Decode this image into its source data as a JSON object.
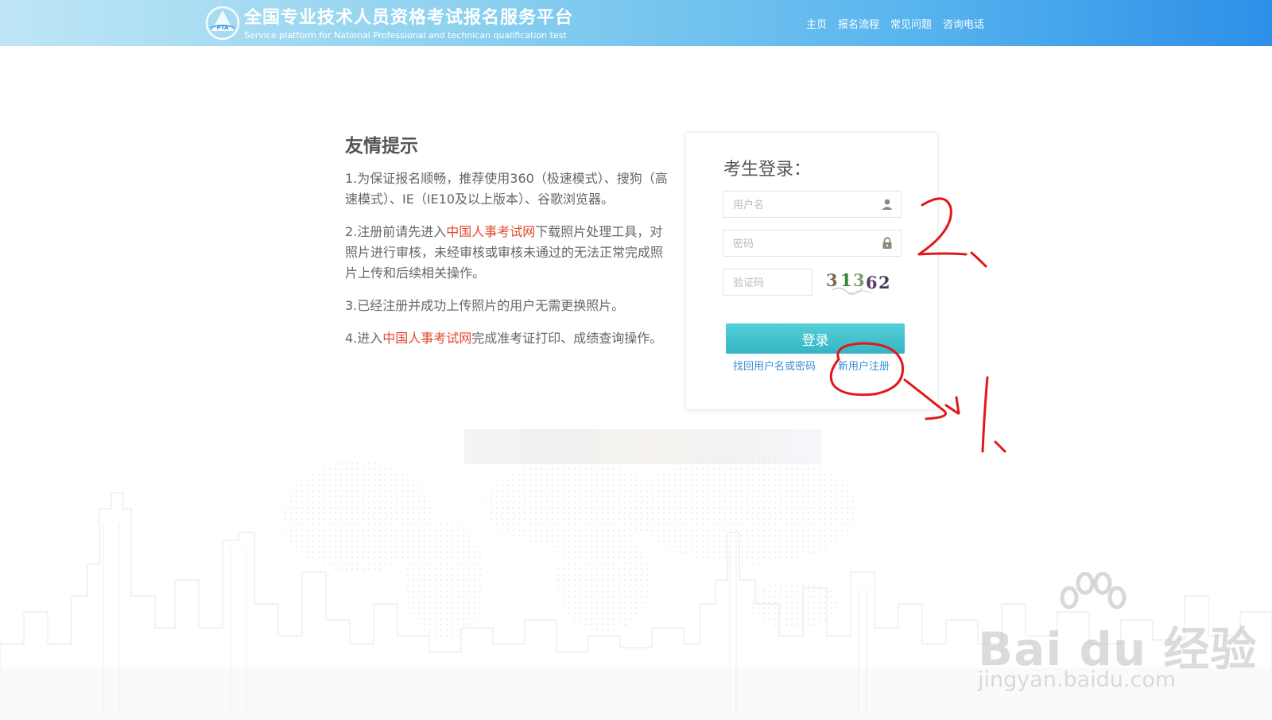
{
  "header": {
    "title": "全国专业技术人员资格考试报名服务平台",
    "subtitle": "Service platform for National Professional and technican qualification test",
    "logo_text": "PTA",
    "nav": [
      "主页",
      "报名流程",
      "常见问题",
      "咨询电话"
    ]
  },
  "tips": {
    "heading": "友情提示",
    "items": [
      {
        "before": "1.为保证报名顺畅，推荐使用360（极速模式）、搜狗（高速模式）、IE（IE10及以上版本）、谷歌浏览器。",
        "link": "",
        "after": ""
      },
      {
        "before": "2.注册前请先进入",
        "link": "中国人事考试网",
        "after": "下载照片处理工具，对照片进行审核，未经审核或审核未通过的无法正常完成照片上传和后续相关操作。"
      },
      {
        "before": "3.已经注册并成功上传照片的用户无需更换照片。",
        "link": "",
        "after": ""
      },
      {
        "before": "4.进入",
        "link": "中国人事考试网",
        "after": "完成准考证打印、成绩查询操作。"
      }
    ]
  },
  "login": {
    "title": "考生登录：",
    "username_placeholder": "用户名",
    "password_placeholder": "密码",
    "captcha_placeholder": "验证码",
    "captcha_chars": [
      "3",
      "1",
      "3",
      "6",
      "2"
    ],
    "login_button": "登录",
    "forgot_link": "找回用户名或密码",
    "register_link": "新用户注册"
  },
  "annotations": {
    "label_two": "2、",
    "label_one": "1、"
  },
  "watermark": {
    "brand": "Bai  du 经验",
    "url": "jingyan.baidu.com"
  },
  "colors": {
    "header_start": "#bfe6f6",
    "header_end": "#2d8fe8",
    "button": "#3dbfcc",
    "link": "#3a8ed4",
    "highlight": "#e04a2e",
    "annotation": "#e01818"
  }
}
